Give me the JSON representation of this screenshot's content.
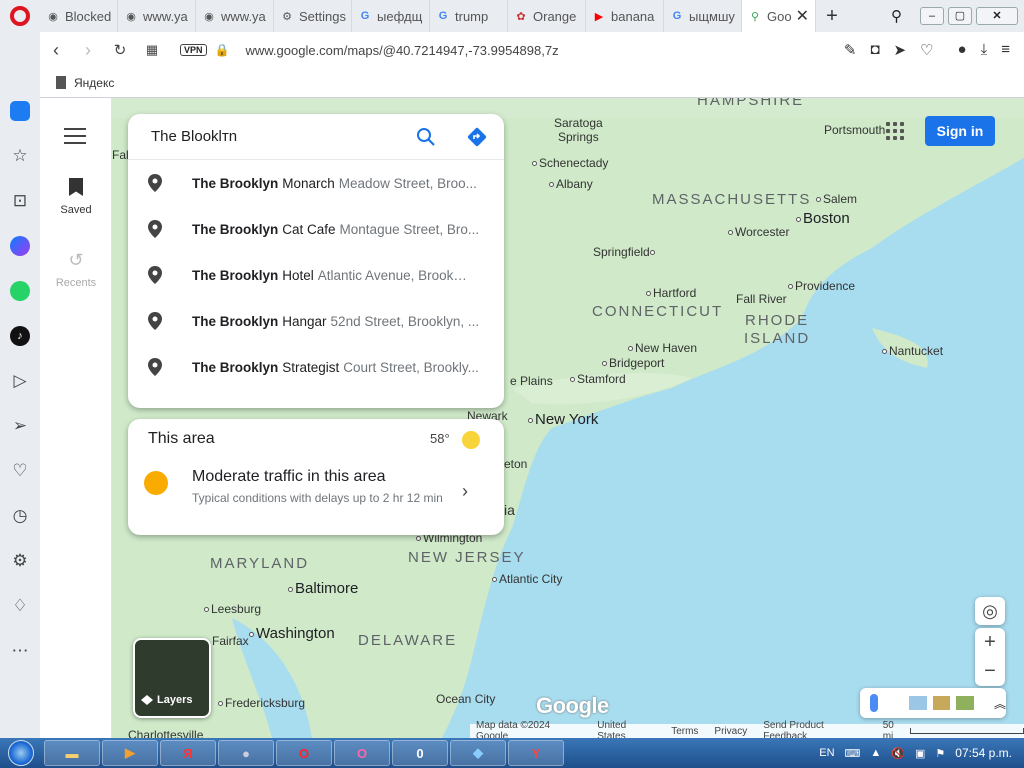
{
  "browser": {
    "tabs": [
      {
        "label": "Blocked",
        "icon": "globe-icon"
      },
      {
        "label": "www.ya",
        "icon": "globe-icon"
      },
      {
        "label": "www.ya",
        "icon": "globe-icon"
      },
      {
        "label": "Settings",
        "icon": "gear-icon"
      },
      {
        "label": "ыефдщ",
        "icon": "google-icon"
      },
      {
        "label": "trump ",
        "icon": "google-icon"
      },
      {
        "label": "Orange",
        "icon": "orange-icon"
      },
      {
        "label": "banana",
        "icon": "youtube-icon"
      },
      {
        "label": "ыщмшу",
        "icon": "google-icon"
      },
      {
        "label": "Goo",
        "icon": "maps-pin-icon"
      }
    ],
    "url": "www.google.com/maps/@40.7214947,-73.9954898,7z",
    "vpn_label": "VPN",
    "bookmark": "Яндекс"
  },
  "maps": {
    "rail": {
      "saved": "Saved",
      "recents": "Recents"
    },
    "search": {
      "value": "The Blooklтn",
      "suggestions": [
        {
          "bold": "The Brooklyn",
          "name": "Monarch",
          "address": "Meadow Street, Broo..."
        },
        {
          "bold": "The Brooklyn",
          "name": "Cat Cafe",
          "address": "Montague Street, Bro..."
        },
        {
          "bold": "The Brooklyn",
          "name": "Hotel",
          "address": "Atlantic Avenue, Brookly..."
        },
        {
          "bold": "The Brooklyn",
          "name": "Hangar",
          "address": "52nd Street, Brooklyn, ..."
        },
        {
          "bold": "The Brooklyn",
          "name": "Strategist",
          "address": "Court Street, Brookly..."
        }
      ]
    },
    "area": {
      "title": "This area",
      "temperature": "58°",
      "traffic_title": "Moderate traffic in this area",
      "traffic_sub": "Typical conditions with delays up to 2 hr 12 min"
    },
    "sign_in": "Sign in",
    "layers": "Layers",
    "logo": "Google",
    "attribution": {
      "data": "Map data ©2024 Google",
      "country": "United States",
      "terms": "Terms",
      "privacy": "Privacy",
      "feedback": "Send Product Feedback",
      "scale": "50 mi"
    },
    "labels": {
      "hampshire": "HAMPSHIRE",
      "massachusetts": "MASSACHUSETTS",
      "connecticut": "CONNECTICUT",
      "rhode1": "RHODE",
      "rhode2": "ISLAND",
      "maryland": "MARYLAND",
      "newjersey": "NEW JERSEY",
      "delaware": "DELAWARE",
      "saratoga1": "Saratoga",
      "saratoga2": "Springs",
      "schenectady": "Schenectady",
      "albany": "Albany",
      "salem": "Salem",
      "boston": "Boston",
      "portsmouth": "Portsmouth",
      "worcester": "Worcester",
      "springfield": "Springfield",
      "hartford": "Hartford",
      "fallriver": "Fall River",
      "providence": "Providence",
      "nantucket": "Nantucket",
      "newhaven": "New Haven",
      "bridgeport": "Bridgeport",
      "stamford": "Stamford",
      "plains": "e Plains",
      "newark": "Newark",
      "newyork": "New York",
      "atlantic": "Atlantic City",
      "wilmington": "Wilmington",
      "baltimore": "Baltimore",
      "washington": "Washington",
      "leesburg": "Leesburg",
      "fredericksburg": "Fredericksburg",
      "oceancity": "Ocean City",
      "charlottesville": "Charlottesville",
      "fairfax": "Fairfax",
      "falc": "Falc",
      "eton": "eton",
      "ia": "ia"
    }
  },
  "taskbar": {
    "lang": "EN",
    "time": "07:54 p.m."
  },
  "colors": {
    "accent": "#1a73e8",
    "opera_red": "#e0141e",
    "water": "#a8dcef",
    "land": "#cfe9c9"
  }
}
